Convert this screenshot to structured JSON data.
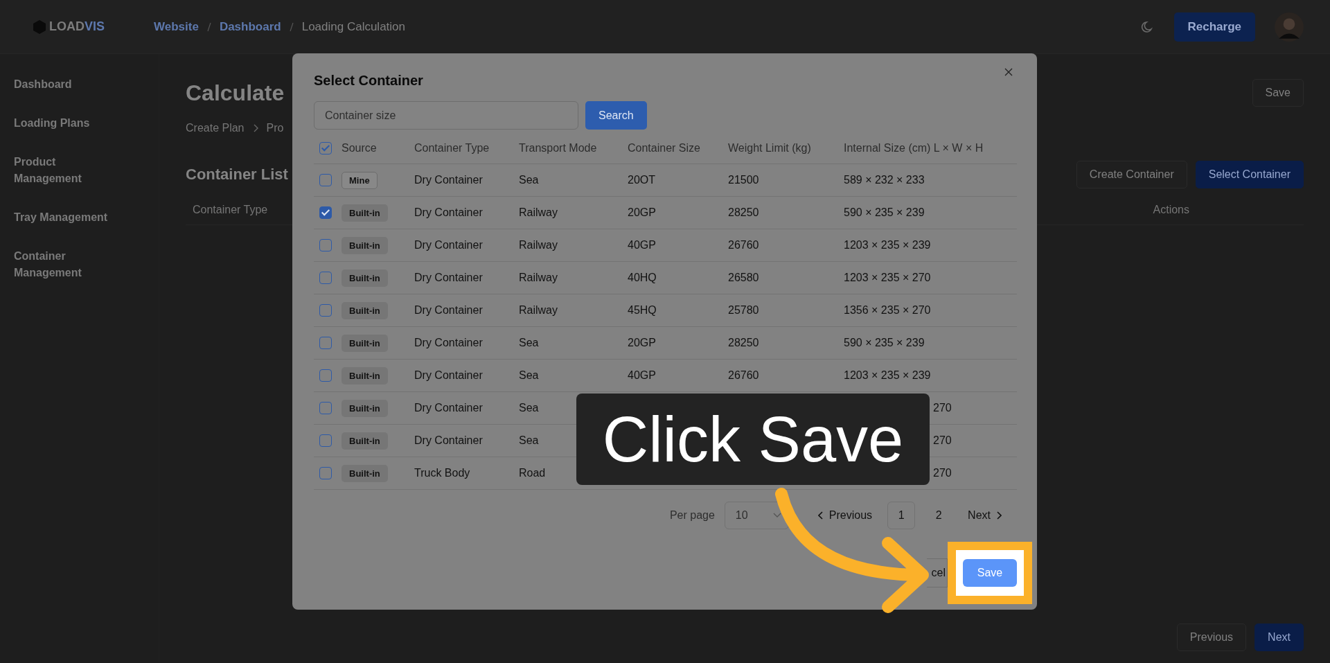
{
  "header": {
    "logo_main": "LOAD",
    "logo_accent": "VIS",
    "breadcrumbs": [
      {
        "label": "Website",
        "link": true
      },
      {
        "label": "Dashboard",
        "link": true
      },
      {
        "label": "Loading Calculation",
        "link": false
      }
    ],
    "recharge_button": "Recharge"
  },
  "sidebar": {
    "items": [
      "Dashboard",
      "Loading Plans",
      "Product Management",
      "Tray Management",
      "Container Management"
    ]
  },
  "page": {
    "title": "Calculate",
    "steps": [
      "Create Plan",
      "Pro"
    ],
    "save_button": "Save",
    "section_title": "Container List",
    "create_button": "Create Container",
    "select_button": "Select Container",
    "columns": [
      "Container Type",
      "Actions"
    ],
    "previous_button": "Previous",
    "next_button": "Next"
  },
  "modal": {
    "title": "Select Container",
    "search": {
      "placeholder": "Container size"
    },
    "search_button": "Search",
    "select_all_checked": true,
    "columns": [
      "Source",
      "Container Type",
      "Transport Mode",
      "Container Size",
      "Weight Limit (kg)",
      "Internal Size (cm) L × W × H"
    ],
    "rows": [
      {
        "checked": false,
        "source": "Mine",
        "kind": "mine",
        "type": "Dry Container",
        "mode": "Sea",
        "size": "20OT",
        "weight": "21500",
        "internal": "589 × 232 × 233"
      },
      {
        "checked": true,
        "source": "Built-in",
        "kind": "builtin",
        "type": "Dry Container",
        "mode": "Railway",
        "size": "20GP",
        "weight": "28250",
        "internal": "590 × 235 × 239"
      },
      {
        "checked": false,
        "source": "Built-in",
        "kind": "builtin",
        "type": "Dry Container",
        "mode": "Railway",
        "size": "40GP",
        "weight": "26760",
        "internal": "1203 × 235 × 239"
      },
      {
        "checked": false,
        "source": "Built-in",
        "kind": "builtin",
        "type": "Dry Container",
        "mode": "Railway",
        "size": "40HQ",
        "weight": "26580",
        "internal": "1203 × 235 × 270"
      },
      {
        "checked": false,
        "source": "Built-in",
        "kind": "builtin",
        "type": "Dry Container",
        "mode": "Railway",
        "size": "45HQ",
        "weight": "25780",
        "internal": "1356 × 235 × 270"
      },
      {
        "checked": false,
        "source": "Built-in",
        "kind": "builtin",
        "type": "Dry Container",
        "mode": "Sea",
        "size": "20GP",
        "weight": "28250",
        "internal": "590 × 235 × 239"
      },
      {
        "checked": false,
        "source": "Built-in",
        "kind": "builtin",
        "type": "Dry Container",
        "mode": "Sea",
        "size": "40GP",
        "weight": "26760",
        "internal": "1203 × 235 × 239"
      },
      {
        "checked": false,
        "source": "Built-in",
        "kind": "builtin",
        "type": "Dry Container",
        "mode": "Sea",
        "internal_tail": "270"
      },
      {
        "checked": false,
        "source": "Built-in",
        "kind": "builtin",
        "type": "Dry Container",
        "mode": "Sea",
        "internal_tail": "270"
      },
      {
        "checked": false,
        "source": "Built-in",
        "kind": "builtin",
        "type": "Truck Body",
        "mode": "Road",
        "internal_tail": "270"
      }
    ],
    "pagination": {
      "per_page_label": "Per page",
      "per_page": "10",
      "previous": "Previous",
      "pages": [
        {
          "label": "1",
          "selected": true
        },
        {
          "label": "2",
          "selected": false
        }
      ],
      "next": "Next"
    },
    "cancel_button": "cel",
    "save_button": "Save"
  },
  "callout": {
    "text": "Click Save"
  }
}
